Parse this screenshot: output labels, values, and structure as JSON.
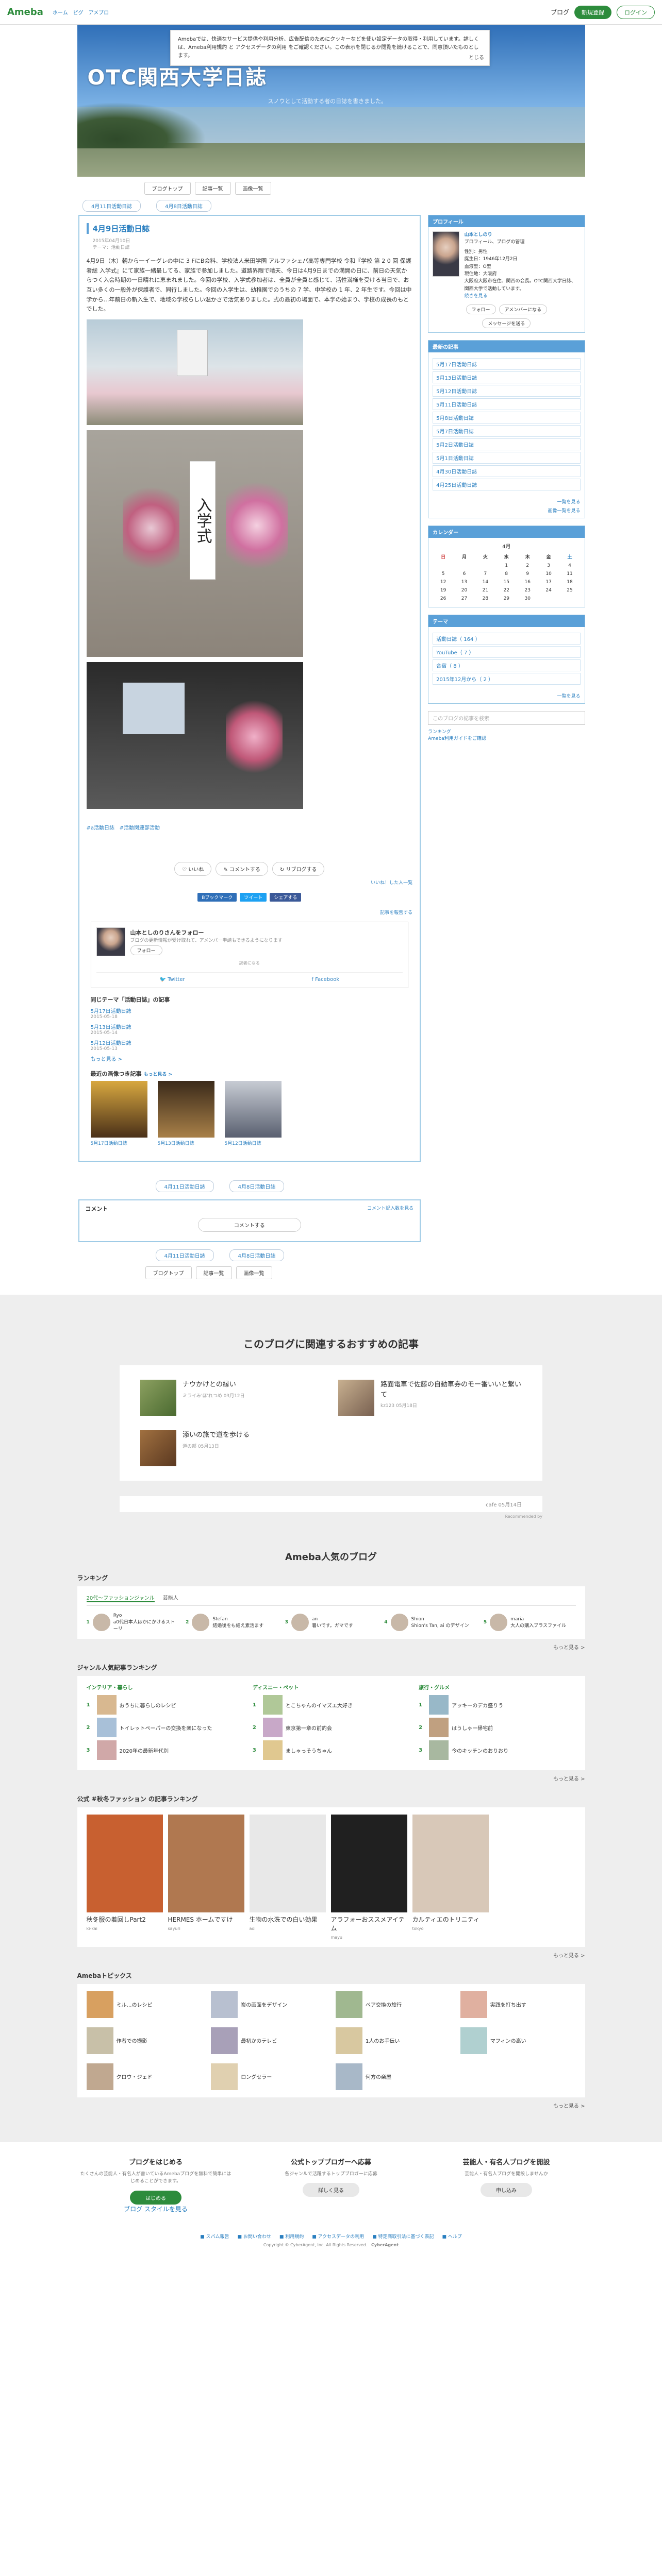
{
  "header": {
    "logo": "Ameba",
    "nav": [
      "ホーム",
      "ピグ",
      "アメブロ"
    ],
    "my_blog": "ブログ",
    "register": "新規登録",
    "login": "ログイン"
  },
  "notice": {
    "text": "Amebaでは、快適なサービス提供や利用分析、広告配信のためにクッキーなどを使い設定データの取得・利用しています。詳しくは、Ameba利用規約 と アクセスデータの利用 をご確認ください。この表示を閉じるか閲覧を続けることで、同意頂いたものとします。",
    "close": "とじる"
  },
  "blog": {
    "title": "OTC関西大学日誌",
    "subtitle": "スノウとして活動する者の日誌を書きました。"
  },
  "blognav": [
    "ブログトップ",
    "記事一覧",
    "画像一覧"
  ],
  "pager": {
    "prev": "4月11日活動日誌",
    "next": "4月8日活動日誌"
  },
  "entry": {
    "title": "4月9日活動日誌",
    "date": "2015年04月10日",
    "theme": "テーマ：活動日誌",
    "body": "4月9日（木）朝から一イーグレの中に 3 FにB会料、学校法人米田学園 アルファシェパ高等専門学校 令和『学校 第 2 0 回 保護者総 入学式』にて家族一緒最してる、家族で参加しました。道路界隈で晴天、今日は4月9日までの満開の日に、前日の天気からつく入会時期の一日晴れに恵まれました。今回の学校、入学式参加者は、全員が全員と感じて、活性満様を受ける当日で、お互い多くの一般外が保護者で、同行しました。今回の入学生は、幼稚園でのうちの 7 学、中学校の 1 年、2 年生です。今回は中学から…年前日の新入生で、地域の学校らしい温かさで活気ありました。式の最初の場面で、本学の始まり、学校の成長のもとでした。",
    "tags_label": "#a活動日誌",
    "tags_value": "#活動関連部活動",
    "actions": [
      "いいね",
      "コメントする",
      "リブログする"
    ],
    "likes": "いいね！した人一覧",
    "share": [
      "Bブックマーク",
      "ツイート",
      "シェアする"
    ],
    "report": "記事を報告する"
  },
  "follow": {
    "name": "山本としのりさんをフォロー",
    "desc": "ブログの更新情報が受け取れて、アメンバー申請もできるようになります",
    "button": "フォロー",
    "sep": "読者になる",
    "twitter": "Twitter",
    "facebook": "Facebook"
  },
  "same_theme": {
    "title": "同じテーマ「活動日誌」の記事",
    "items": [
      {
        "t": "5月17日活動日誌",
        "d": "2015-05-18"
      },
      {
        "t": "5月13日活動日誌",
        "d": "2015-05-14"
      },
      {
        "t": "5月12日活動日誌",
        "d": "2015-05-13"
      }
    ],
    "more": "もっと見る >"
  },
  "recent_imgs": {
    "title": "最近の画像つき記事",
    "more": "もっと見る >",
    "items": [
      "5月17日活動日誌",
      "5月13日活動日誌",
      "5月12日活動日誌"
    ]
  },
  "comments": {
    "title": "コメント",
    "link": "コメント記入数を見る",
    "button": "コメントする"
  },
  "sidebar": {
    "profile_title": "プロフィール",
    "profile_name": "山本としのり",
    "profile_sub": "プロフィール、ブログの管理",
    "profile_text": "性別：男性\n誕生日：1946年12月2日\n血液型：O型\n現住地：大阪府\n大阪府大阪市在住、関西の会長。OTC関西大学日誌、関西大学で活動しています。",
    "more": "続きを見る",
    "follow": "フォロー",
    "amenba": "アメンバーになる",
    "message": "メッセージを送る",
    "latest_title": "最新の記事",
    "latest": [
      "5月17日活動日誌",
      "5月13日活動日誌",
      "5月12日活動日誌",
      "5月11日活動日誌",
      "5月8日活動日誌",
      "5月7日活動日誌",
      "5月2日活動日誌",
      "5月1日活動日誌",
      "4月30日活動日誌",
      "4月25日活動日誌"
    ],
    "list_more": "一覧を見る",
    "img_more": "画像一覧を見る",
    "calendar_title": "カレンダー",
    "cal_month": "4月",
    "cal_head": [
      "日",
      "月",
      "火",
      "水",
      "木",
      "金",
      "土"
    ],
    "cal_rows": [
      [
        "",
        "",
        "",
        "1",
        "2",
        "3",
        "4"
      ],
      [
        "5",
        "6",
        "7",
        "8",
        "9",
        "10",
        "11"
      ],
      [
        "12",
        "13",
        "14",
        "15",
        "16",
        "17",
        "18"
      ],
      [
        "19",
        "20",
        "21",
        "22",
        "23",
        "24",
        "25"
      ],
      [
        "26",
        "27",
        "28",
        "29",
        "30",
        "",
        ""
      ]
    ],
    "theme_title": "テーマ",
    "themes": [
      "活動日誌（ 164 ）",
      "YouTube（ 7 ）",
      "合宿（ 8 ）",
      "2015年12月から（ 2 ）"
    ],
    "theme_more": "一覧を見る",
    "search_ph": "このブログの記事を検索",
    "ranking": "ランキング",
    "report": "Ameba利用ガイドをご確認"
  },
  "reco": {
    "title": "このブログに関連するおすすめの記事",
    "items": [
      {
        "t": "ナウかけとの縁い",
        "m": "ミライみ'ほ'れつめ 03月12日"
      },
      {
        "t": "路面電車で佐藤の自動車券のモー番いいと繋いて",
        "m": "kz123 05月18日"
      },
      {
        "t": "添いの旅で道を歩ける",
        "m": "道の部 05月13日"
      }
    ],
    "extra_right": "cafe 05月14日",
    "powered": "Recommended by"
  },
  "popular": {
    "title": "Ameba人気のブログ",
    "ranking_title": "ランキング",
    "tabs": [
      "20代〜ファッションジャンル",
      "芸能人"
    ],
    "rank_items": [
      {
        "n": "1",
        "name": "Ryo",
        "t": "a0代日本人ほかにかけるストーリ"
      },
      {
        "n": "2",
        "name": "Stefan",
        "t": "結婚後をも結え素活ます"
      },
      {
        "n": "3",
        "name": "an",
        "t": "暑いです。ガマです"
      },
      {
        "n": "4",
        "name": "Shion",
        "t": "Shion's Tan, ai のデザイン"
      },
      {
        "n": "5",
        "name": "maria",
        "t": "大人の購入プラスファイル"
      }
    ],
    "more": "もっと見る >",
    "genre_title": "ジャンル人気記事ランキング",
    "genres": [
      {
        "h": "インテリア・暮らし",
        "items": [
          "おうちに暮らしのレシピ",
          "トイレットペーパーの交換を楽になった",
          "2020年の最新年代別"
        ]
      },
      {
        "h": "ディスニー・ペット",
        "items": [
          "とこちゃんのイマズエ大好き",
          "東京第一章の前的会",
          "ましゃっそうちゃん"
        ]
      },
      {
        "h": "旅行・グルメ",
        "items": [
          "アッキーのデカ盛りう",
          "はうしゃー帰宅前",
          "今のキッチンのおりおり"
        ]
      }
    ],
    "fashion_title": "公式 #秋冬ファッション の記事ランキング",
    "fashion": [
      {
        "t": "秋冬服の着回しPart2",
        "m": "ki-kai"
      },
      {
        "t": "HERMES ホームですけ",
        "m": "sayuri"
      },
      {
        "t": "生物の水洗での白い効果",
        "m": "aoi"
      },
      {
        "t": "アラフォーおススメアイテム",
        "m": "mayu"
      },
      {
        "t": "カルティエのトリニティ",
        "m": "tokyo"
      }
    ],
    "topics_title": "Amebaトピックス",
    "topics": [
      "ミル…のレシピ",
      "炭の画面をデザイン",
      "ペア交換の旅行",
      "実践を打ち出す",
      "作者での撮影",
      "最初かのテレビ",
      "1人のお手伝い",
      "マフィンの高い",
      "クロウ・ジェド",
      "ロングセラー",
      "何方の楽屋",
      ""
    ]
  },
  "cta": [
    {
      "h": "ブログをはじめる",
      "p": "たくさんの芸能人・有名人が書いているAmebaブログを無料で簡単にはじめることができます。",
      "b": "はじめる",
      "s": "ブログ スタイルを見る"
    },
    {
      "h": "公式トップブロガーへ応募",
      "p": "各ジャンルで活躍するトップブロガーに応募",
      "b": "詳しく見る",
      "s": ""
    },
    {
      "h": "芸能人・有名人ブログを開設",
      "p": "芸能人・有名人ブログを開設しませんか",
      "b": "申し込み",
      "s": ""
    }
  ],
  "footer": {
    "nav": [
      "スパム報告",
      "お問い合わせ",
      "利用規約",
      "アクセスデータの利用",
      "特定商取引法に基づく表記",
      "ヘルプ"
    ],
    "copy": "Copyright © CyberAgent, Inc. All Rights Reserved.",
    "brand": "CyberAgent"
  }
}
